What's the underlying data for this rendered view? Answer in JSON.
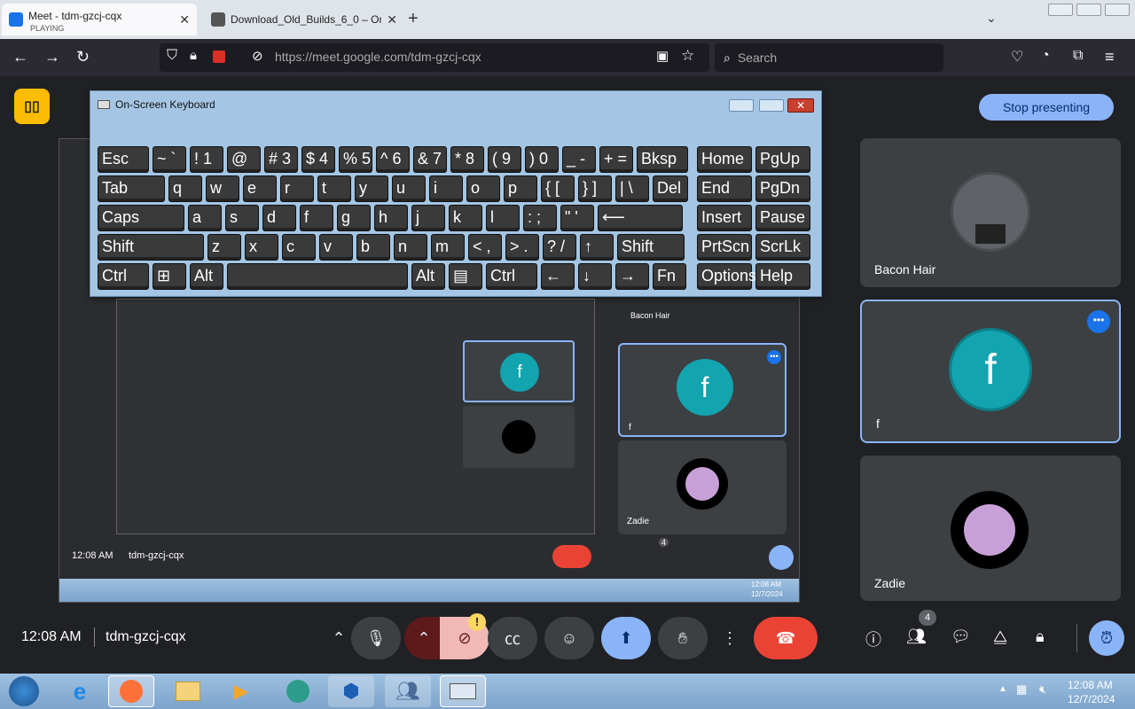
{
  "browser": {
    "tabs": [
      {
        "title": "Meet - tdm-gzcj-cqx",
        "subtitle": "PLAYING"
      },
      {
        "title": "Download_Old_Builds_6_0 – On"
      }
    ],
    "url": "https://meet.google.com/tdm-gzcj-cqx",
    "search_placeholder": "Search"
  },
  "meet": {
    "stop_presenting": "Stop presenting",
    "time": "12:08 AM",
    "meeting_code": "tdm-gzcj-cqx",
    "people_count": "4",
    "participants": [
      {
        "name": "Bacon Hair"
      },
      {
        "name": "f",
        "initial": "f"
      },
      {
        "name": "Zadie"
      }
    ]
  },
  "nested_preview": {
    "time": "12:08 AM",
    "code": "tdm-gzcj-cqx",
    "count": "4",
    "tiles": [
      {
        "name": "Bacon Hair"
      },
      {
        "name": "f",
        "initial": "f"
      },
      {
        "name": "Zadie"
      }
    ],
    "taskbar_time": "12:08 AM",
    "taskbar_date": "12/7/2024"
  },
  "osk": {
    "title": "On-Screen Keyboard",
    "rows": [
      [
        "Esc",
        "~ `",
        "! 1",
        "@ 2",
        "# 3",
        "$ 4",
        "% 5",
        "^ 6",
        "& 7",
        "* 8",
        "( 9",
        ") 0",
        "_ -",
        "+ =",
        "Bksp",
        "Home",
        "PgUp"
      ],
      [
        "Tab",
        "q",
        "w",
        "e",
        "r",
        "t",
        "y",
        "u",
        "i",
        "o",
        "p",
        "{ [",
        "} ]",
        "| \\",
        "Del",
        "End",
        "PgDn"
      ],
      [
        "Caps",
        "a",
        "s",
        "d",
        "f",
        "g",
        "h",
        "j",
        "k",
        "l",
        ": ;",
        "\" '",
        "⟵",
        "Insert",
        "Pause"
      ],
      [
        "Shift",
        "z",
        "x",
        "c",
        "v",
        "b",
        "n",
        "m",
        "< ,",
        "> .",
        "? /",
        "↑",
        "Shift",
        "PrtScn",
        "ScrLk"
      ],
      [
        "Ctrl",
        "⊞",
        "Alt",
        "",
        "Alt",
        "▤",
        "Ctrl",
        "←",
        "↓",
        "→",
        "Fn",
        "Options",
        "Help"
      ]
    ]
  },
  "taskbar": {
    "time": "12:08 AM",
    "date": "12/7/2024"
  }
}
